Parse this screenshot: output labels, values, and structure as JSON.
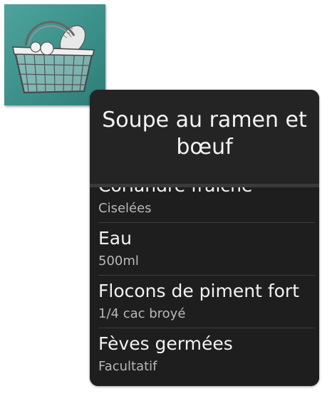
{
  "app_icon": {
    "name": "shopping-basket-icon"
  },
  "dialog": {
    "title": "Soupe au ramen et bœuf",
    "items": [
      {
        "name": "Coriandre fraîche",
        "detail": "Ciselées"
      },
      {
        "name": "Eau",
        "detail": "500ml"
      },
      {
        "name": "Flocons de piment fort",
        "detail": "1/4 cac broyé"
      },
      {
        "name": "Fèves germées",
        "detail": "Facultatif"
      }
    ]
  },
  "colors": {
    "icon_background": "#3a8e88",
    "dialog_background": "#242424",
    "list_background": "#1e1e1e",
    "primary_text": "#f2f2f2",
    "secondary_text": "#b8b8b8"
  }
}
